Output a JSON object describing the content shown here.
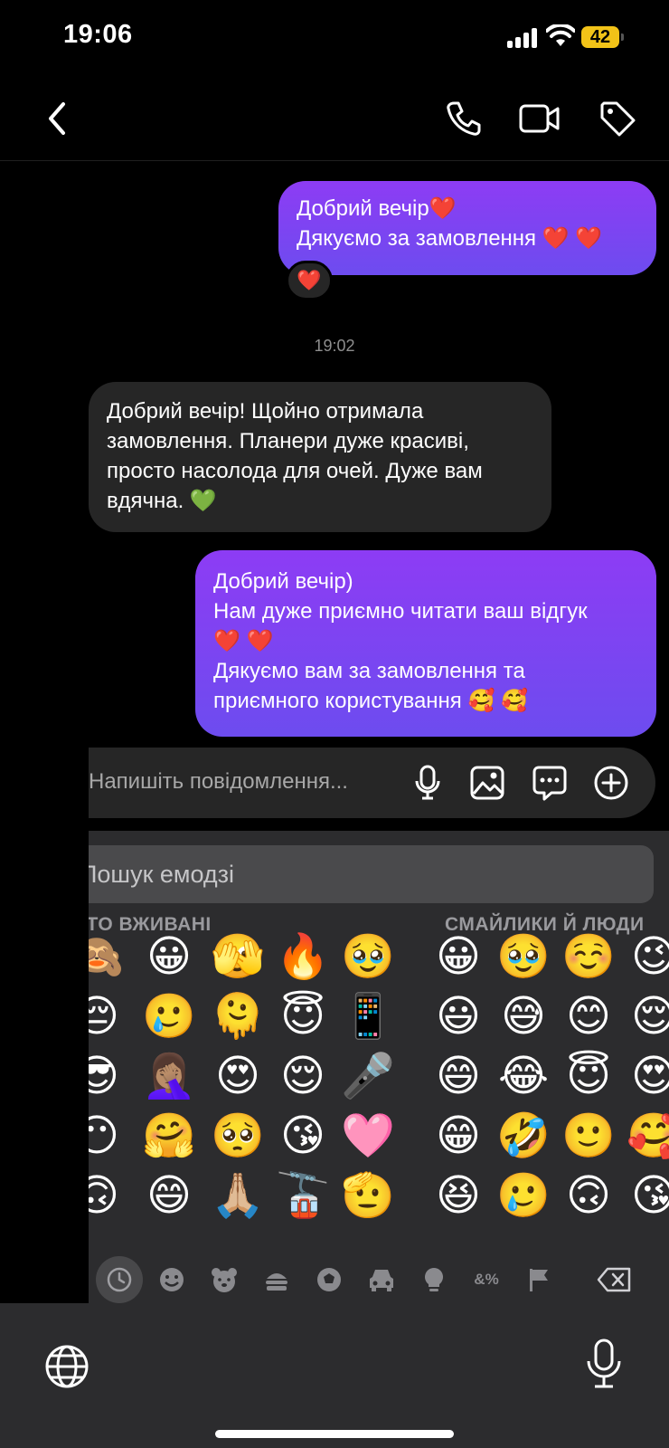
{
  "status_bar": {
    "time": "19:06",
    "battery": "42"
  },
  "header": {
    "back_icon": "chevron-left-icon",
    "call_icon": "phone-icon",
    "video_icon": "video-camera-icon",
    "tag_icon": "tag-icon"
  },
  "messages": [
    {
      "direction": "outgoing",
      "lines": [
        "Добрий вечір❤️",
        "Дякуємо за замовлення ❤️ ❤️"
      ],
      "reaction": "❤️"
    },
    {
      "direction": "timestamp",
      "text": "19:02"
    },
    {
      "direction": "incoming",
      "lines": [
        "Добрий вечір! Щойно отримала",
        "замовлення. Планери дуже красиві,",
        "просто насолода для очей. Дуже вам",
        "вдячна. 💚"
      ]
    },
    {
      "direction": "outgoing",
      "lines": [
        "Добрий вечір)",
        "Нам дуже приємно читати ваш відгук",
        "❤️ ❤️",
        "Дякуємо вам за замовлення та",
        "приємного користування 🥰 🥰"
      ]
    }
  ],
  "composer": {
    "placeholder": "Напишіть повідомлення..."
  },
  "emoji_keyboard": {
    "search_placeholder": "Пошук емодзі",
    "sections": [
      "ЧАСТО ВЖИВАНІ",
      "СМАЙЛИКИ Й ЛЮДИ"
    ],
    "frequent_grid": [
      [
        "🙈",
        "😀",
        "🫣",
        "🔥",
        "🥹"
      ],
      [
        "😔",
        "🥲",
        "🫠",
        "😇",
        "📱"
      ],
      [
        "😎",
        "🤦🏽‍♀️",
        "😍",
        "😌",
        "🎤"
      ],
      [
        "😶",
        "🤗",
        "🥺",
        "😘",
        "🩷"
      ],
      [
        "🙃",
        "😄",
        "🙏🏼",
        "🚡",
        "🫡"
      ]
    ],
    "smileys_grid": [
      [
        "😀",
        "🥹",
        "☺️",
        "😉"
      ],
      [
        "😃",
        "😅",
        "😊",
        "😌"
      ],
      [
        "😄",
        "😂",
        "😇",
        "😍"
      ],
      [
        "😁",
        "🤣",
        "🙂",
        "🥰"
      ],
      [
        "😆",
        "🥲",
        "🙃",
        "😘"
      ]
    ],
    "categories": [
      "recent-clock-icon",
      "smiley-icon",
      "bear-icon",
      "food-icon",
      "ball-icon",
      "car-icon",
      "lightbulb-icon",
      "symbols-icon",
      "flag-icon",
      "backspace-icon"
    ],
    "symbols_label": "&%"
  },
  "bottom_bar": {
    "globe_icon": "globe-icon",
    "mic_icon": "microphone-icon"
  }
}
